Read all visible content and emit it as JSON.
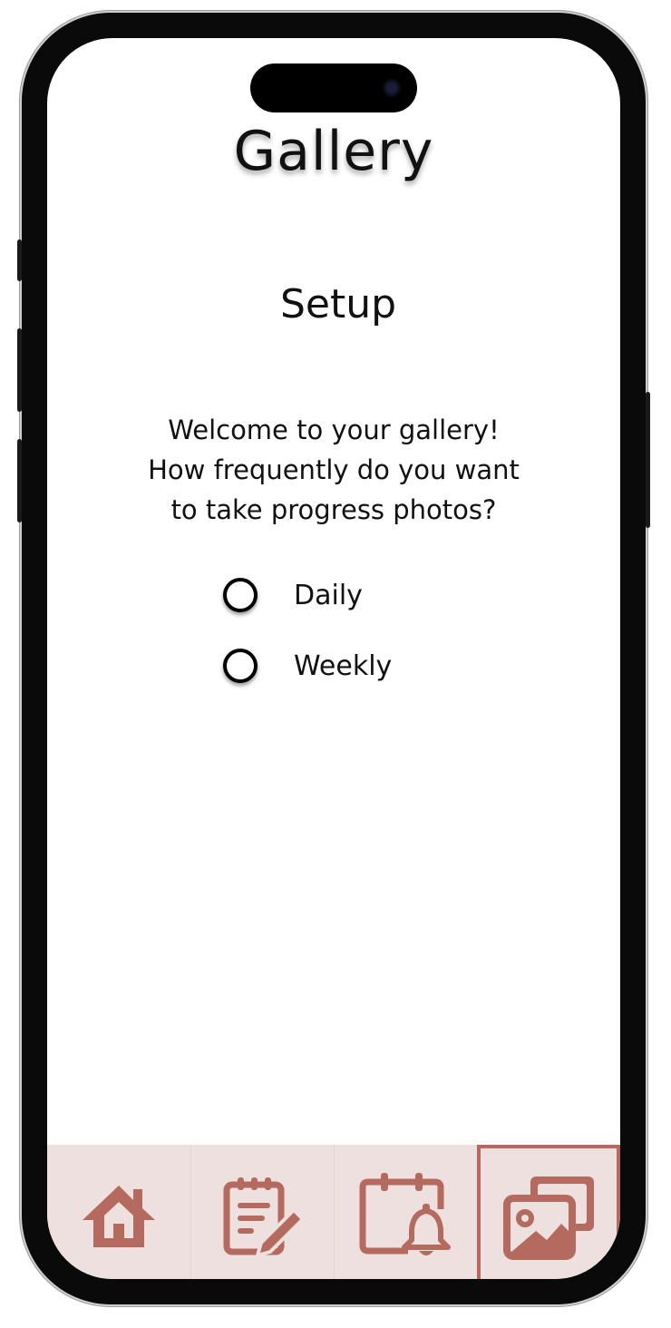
{
  "header": {
    "title": "Gallery"
  },
  "setup": {
    "heading": "Setup",
    "prompt_lines": [
      "Welcome to your gallery!",
      "How frequently do you want",
      "to take progress photos?"
    ],
    "options": [
      {
        "label": "Daily",
        "selected": false
      },
      {
        "label": "Weekly",
        "selected": false
      }
    ]
  },
  "tabbar": {
    "accent_color": "#b56a60",
    "background_color": "#ede0de",
    "tabs": [
      {
        "icon": "home-icon",
        "active": false
      },
      {
        "icon": "notes-edit-icon",
        "active": false
      },
      {
        "icon": "calendar-reminder-icon",
        "active": false
      },
      {
        "icon": "gallery-photos-icon",
        "active": true
      }
    ]
  }
}
